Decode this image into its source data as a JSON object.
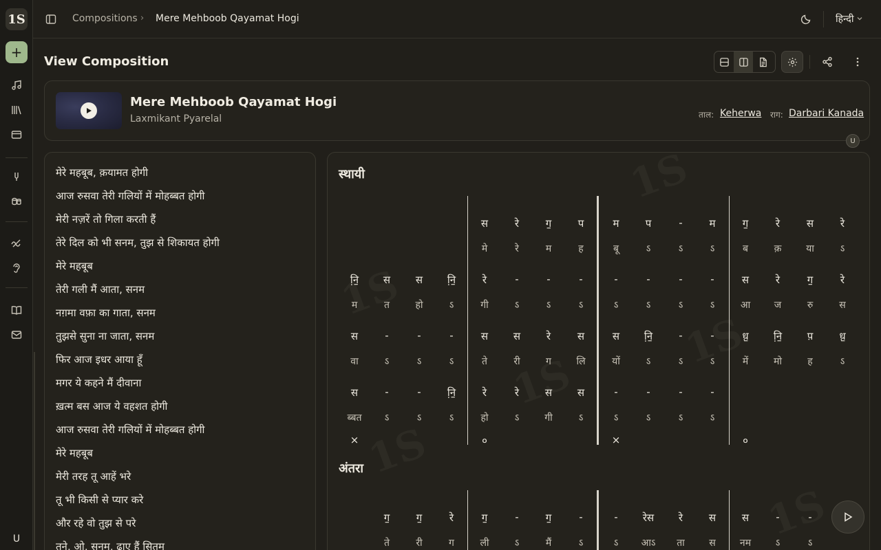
{
  "app": {
    "logo_text": "1S",
    "user_initial": "U"
  },
  "breadcrumb": {
    "parent": "Compositions",
    "separator": "›",
    "current": "Mere Mehboob Qayamat Hogi"
  },
  "topbar": {
    "language": "हिन्दी"
  },
  "page": {
    "title": "View Composition"
  },
  "song": {
    "title": "Mere Mehboob Qayamat Hogi",
    "artist": "Laxmikant Pyarelal",
    "tal_label": "ताल:",
    "tal": "Keherwa",
    "raga_label": "राग:",
    "raga": "Darbari Kanada",
    "collaborator_initial": "U"
  },
  "lyrics": [
    "मेरे महबूब, क़यामत होगी",
    "आज रुसवा तेरी गलियों में मोहब्बत होगी",
    "मेरी नज़रें तो गिला करती हैं",
    "तेरे दिल को भी सनम, तुझ से शिकायत होगी",
    "मेरे महबूब",
    "तेरी गली मैं आता, सनम",
    "नग़मा वफ़ा का गाता, सनम",
    "तुझसे सुना ना जाता, सनम",
    "फिर आज इधर आया हूँ",
    "मगर ये कहने मैं दीवाना",
    "ख़त्म बस आज ये वहशत होगी",
    "आज रुसवा तेरी गलियों में मोहब्बत होगी",
    "मेरे महबूब",
    "मेरी तरह तू आहें भरे",
    "तू भी किसी से प्यार करे",
    "और रहे वो तुझ से परे",
    "तूने, ओ, सनम, ढाए हैं सितम"
  ],
  "sections": [
    {
      "title": "स्थायी",
      "rows": [
        {
          "notes": [
            "",
            "",
            "",
            "",
            "स",
            "रे",
            "ग॒",
            "प",
            "म",
            "प",
            "-",
            "म",
            "ग॒",
            "रे",
            "स",
            "रे"
          ],
          "lyrics": [
            "",
            "",
            "",
            "",
            "मे",
            "रे",
            "म",
            "ह",
            "बू",
            "ऽ",
            "ऽ",
            "ऽ",
            "ब",
            "क़",
            "या",
            "ऽ"
          ]
        },
        {
          "notes": [
            "नि़॒",
            "स",
            "स",
            "नि़॒",
            "रे",
            "-",
            "-",
            "-",
            "-",
            "-",
            "-",
            "-",
            "स",
            "रे",
            "ग॒",
            "रे"
          ],
          "lyrics": [
            "म",
            "त",
            "हो",
            "ऽ",
            "गी",
            "ऽ",
            "ऽ",
            "ऽ",
            "ऽ",
            "ऽ",
            "ऽ",
            "ऽ",
            "आ",
            "ज",
            "रु",
            "स"
          ]
        },
        {
          "notes": [
            "स",
            "-",
            "-",
            "-",
            "स",
            "स",
            "रे",
            "स",
            "स",
            "नि़॒",
            "-",
            "-",
            "ध़॒",
            "नि़॒",
            "प़",
            "ध़॒"
          ],
          "lyrics": [
            "वा",
            "ऽ",
            "ऽ",
            "ऽ",
            "ते",
            "री",
            "ग",
            "लि",
            "यों",
            "ऽ",
            "ऽ",
            "ऽ",
            "में",
            "मो",
            "ह",
            "ऽ"
          ]
        },
        {
          "notes": [
            "स",
            "-",
            "-",
            "नि़॒",
            "रे",
            "रे",
            "स",
            "स",
            "-",
            "-",
            "-",
            "-",
            "",
            "",
            "",
            ""
          ],
          "lyrics": [
            "ब्बत",
            "ऽ",
            "ऽ",
            "ऽ",
            "हो",
            "ऽ",
            "गी",
            "ऽ",
            "ऽ",
            "ऽ",
            "ऽ",
            "ऽ",
            "",
            "",
            "",
            ""
          ]
        }
      ],
      "taal_marks": [
        "×",
        "०",
        "×",
        "०"
      ]
    },
    {
      "title": "अंतरा",
      "rows": [
        {
          "notes": [
            "",
            "ग॒",
            "ग॒",
            "रे",
            "ग॒",
            "-",
            "ग॒",
            "-",
            "-",
            "रेस",
            "रे",
            "स",
            "स",
            "-",
            "-",
            ""
          ],
          "lyrics": [
            "",
            "ते",
            "री",
            "ग",
            "ली",
            "ऽ",
            "मैं",
            "ऽ",
            "ऽ",
            "आऽ",
            "ता",
            "स",
            "नम",
            "ऽ",
            "ऽ",
            ""
          ]
        }
      ]
    }
  ],
  "colors": {
    "background": "#211f1a",
    "accent": "#9fb88c",
    "panel": "#24221c"
  }
}
